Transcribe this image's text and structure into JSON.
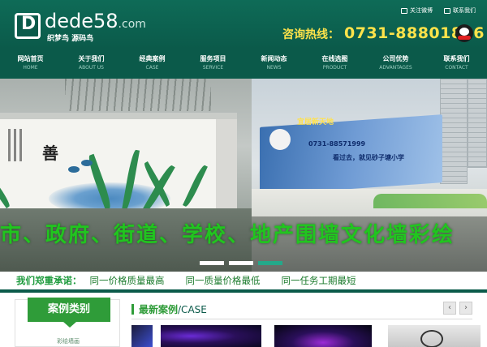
{
  "topbar": {
    "follow_weibo": "关注微博",
    "contact_us": "联系我们"
  },
  "logo": {
    "name": "dede58",
    "domain": ".com",
    "tagline": "织梦鸟 源码鸟"
  },
  "hotline": {
    "label": "咨询热线：",
    "number": "0731-88801806"
  },
  "nav": {
    "items": [
      {
        "cn": "网站首页",
        "en": "HOME"
      },
      {
        "cn": "关于我们",
        "en": "ABOUT US"
      },
      {
        "cn": "经典案例",
        "en": "CASE"
      },
      {
        "cn": "服务项目",
        "en": "SERVICE"
      },
      {
        "cn": "新闻动态",
        "en": "NEWS"
      },
      {
        "cn": "在线选图",
        "en": "PRODUCT"
      },
      {
        "cn": "公司优势",
        "en": "ADVANTAGES"
      },
      {
        "cn": "联系我们",
        "en": "CONTACT"
      }
    ]
  },
  "banner": {
    "slogan": "市、政府、街道、学校、地产围墙文化墙彩绘",
    "wall_char": "善",
    "billboard_head": "宜居新天地",
    "billboard_phone": "0731-88571999",
    "billboard_text": "看过去，就见砂子塘小学"
  },
  "promise": {
    "title": "我们郑重承诺：",
    "items": [
      "同一价格质量最高",
      "同一质量价格最低",
      "同一任务工期最短"
    ]
  },
  "sidebar": {
    "category_title": "案例类别",
    "first_item": "彩绘墙画"
  },
  "cases": {
    "title_cn": "最新案例",
    "title_en": "/CASE",
    "prev": "‹",
    "next": "›"
  },
  "colors": {
    "header_bg": "#0b5a4a",
    "accent_green": "#2f9c39",
    "hotline_yellow": "#ffe34a",
    "slogan_green": "#21c51f"
  }
}
